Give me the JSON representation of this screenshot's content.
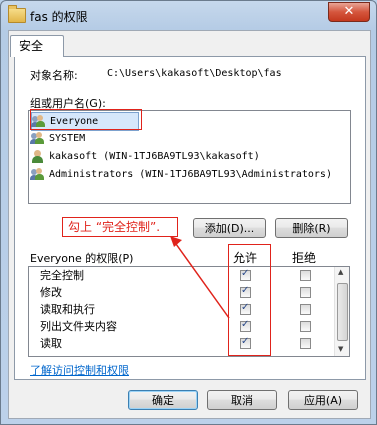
{
  "window": {
    "title": "fas 的权限",
    "close_glyph": "✕"
  },
  "tabs": [
    {
      "label": "安全"
    }
  ],
  "object": {
    "label": "对象名称:",
    "value": "C:\\Users\\kakasoft\\Desktop\\fas"
  },
  "groups": {
    "label": "组或用户名(G):",
    "items": [
      {
        "name": "Everyone",
        "selected": true,
        "icon": "user-group-icon"
      },
      {
        "name": "SYSTEM",
        "selected": false,
        "icon": "user-group-icon"
      },
      {
        "name": "kakasoft (WIN-1TJ6BA9TL93\\kakasoft)",
        "selected": false,
        "icon": "user-icon"
      },
      {
        "name": "Administrators (WIN-1TJ6BA9TL93\\Administrators)",
        "selected": false,
        "icon": "user-group-icon"
      }
    ]
  },
  "annotation": {
    "text": "勾上 “完全控制”."
  },
  "buttons": {
    "add": "添加(D)...",
    "remove": "删除(R)"
  },
  "permissions": {
    "label": "Everyone 的权限(P)",
    "allow_header": "允许",
    "deny_header": "拒绝",
    "rows": [
      {
        "name": "完全控制",
        "allow": true,
        "deny": false
      },
      {
        "name": "修改",
        "allow": true,
        "deny": false
      },
      {
        "name": "读取和执行",
        "allow": true,
        "deny": false
      },
      {
        "name": "列出文件夹内容",
        "allow": true,
        "deny": false
      },
      {
        "name": "读取",
        "allow": true,
        "deny": false
      }
    ]
  },
  "link": "了解访问控制和权限",
  "footer": {
    "ok": "确定",
    "cancel": "取消",
    "apply": "应用(A)"
  },
  "colors": {
    "annotation": "#e0231b",
    "link": "#0066cc",
    "selection": "#d6e7fb"
  }
}
